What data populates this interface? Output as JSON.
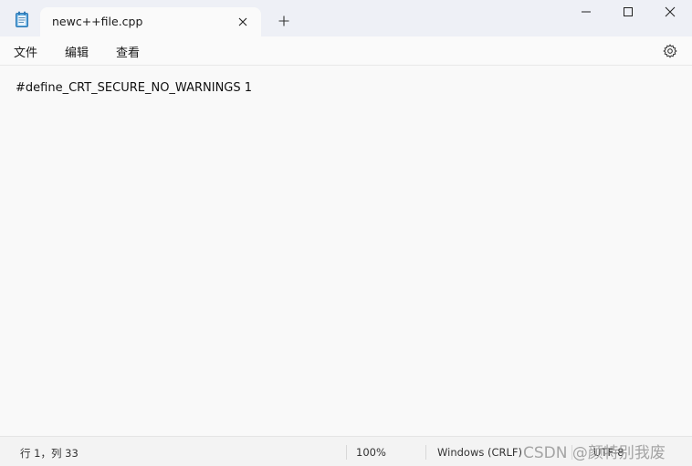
{
  "tab": {
    "title": "newc++file.cpp"
  },
  "menu": {
    "file": "文件",
    "edit": "编辑",
    "view": "查看"
  },
  "icons": {
    "app": "notepad-icon",
    "close_tab": "close-icon",
    "new_tab": "plus-icon",
    "minimize": "minimize-icon",
    "maximize": "maximize-icon",
    "close_window": "close-icon",
    "settings": "gear-icon"
  },
  "editor": {
    "content": "#define_CRT_SECURE_NO_WARNINGS 1"
  },
  "status": {
    "position": "行 1，列 33",
    "zoom": "100%",
    "line_ending": "Windows (CRLF)",
    "encoding": "UTF-8"
  },
  "watermark": "CSDN @颜特别我废"
}
